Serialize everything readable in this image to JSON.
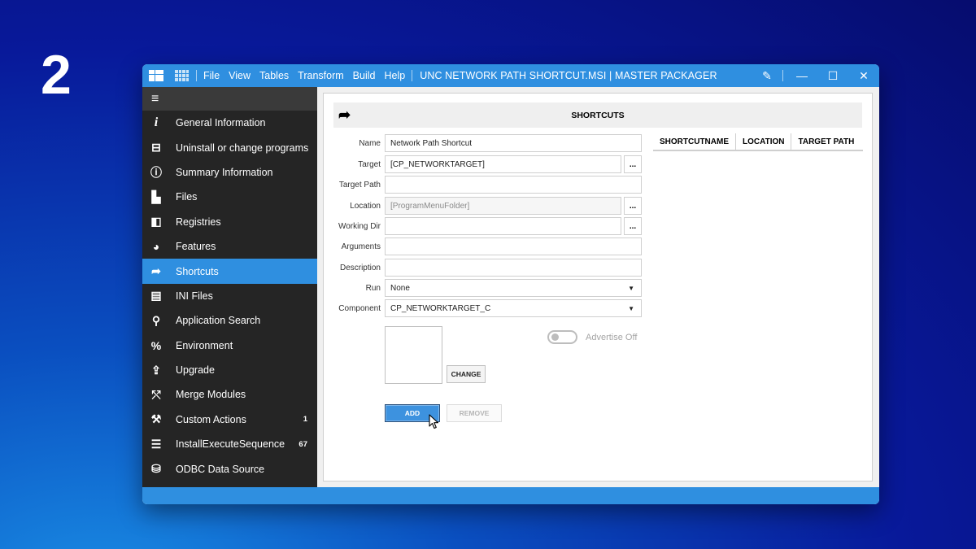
{
  "step": "2",
  "titlebar": {
    "menus": [
      "File",
      "View",
      "Tables",
      "Transform",
      "Build",
      "Help"
    ],
    "title": "UNC NETWORK PATH SHORTCUT.MSI | MASTER PACKAGER",
    "controls": {
      "pen": "✎",
      "minimize": "—",
      "maximize": "☐",
      "close": "✕"
    }
  },
  "sidebar": {
    "menu_icon": "≡",
    "items": [
      {
        "label": "General Information",
        "icon": "info-italic-icon",
        "glyph": "i"
      },
      {
        "label": "Uninstall or change programs",
        "icon": "uninstall-icon",
        "glyph": "⊟"
      },
      {
        "label": "Summary Information",
        "icon": "info-circle-icon",
        "glyph": "ⓘ"
      },
      {
        "label": "Files",
        "icon": "file-icon",
        "glyph": "▙"
      },
      {
        "label": "Registries",
        "icon": "registry-icon",
        "glyph": "◧"
      },
      {
        "label": "Features",
        "icon": "pie-icon",
        "glyph": "◕"
      },
      {
        "label": "Shortcuts",
        "icon": "shortcut-arrow-icon",
        "glyph": "➦"
      },
      {
        "label": "INI Files",
        "icon": "document-icon",
        "glyph": "▤"
      },
      {
        "label": "Application Search",
        "icon": "search-icon",
        "glyph": "⚲"
      },
      {
        "label": "Environment",
        "icon": "percent-icon",
        "glyph": "%"
      },
      {
        "label": "Upgrade",
        "icon": "upload-icon",
        "glyph": "⇪"
      },
      {
        "label": "Merge Modules",
        "icon": "merge-icon",
        "glyph": "⤲"
      },
      {
        "label": "Custom Actions",
        "icon": "tools-icon",
        "glyph": "⚒",
        "badge": "1"
      },
      {
        "label": "InstallExecuteSequence",
        "icon": "list-icon",
        "glyph": "☰",
        "badge": "67"
      },
      {
        "label": "ODBC Data Source",
        "icon": "database-icon",
        "glyph": "⛁"
      }
    ],
    "active_index": 6
  },
  "panel": {
    "title": "SHORTCUTS",
    "header_icon": "➦",
    "fields": {
      "name": {
        "label": "Name",
        "value": "Network Path Shortcut"
      },
      "target": {
        "label": "Target",
        "value": "[CP_NETWORKTARGET]"
      },
      "target_path": {
        "label": "Target Path",
        "value": ""
      },
      "location": {
        "label": "Location",
        "value": "[ProgramMenuFolder]"
      },
      "working_dir": {
        "label": "Working Dir",
        "value": ""
      },
      "arguments": {
        "label": "Arguments",
        "value": ""
      },
      "description": {
        "label": "Description",
        "value": ""
      },
      "run": {
        "label": "Run",
        "value": "None"
      },
      "component": {
        "label": "Component",
        "value": "CP_NETWORKTARGET_C"
      }
    },
    "browse_label": "...",
    "change_label": "CHANGE",
    "advertise_label": "Advertise Off",
    "advertise_on": false,
    "add_label": "ADD",
    "remove_label": "REMOVE",
    "table_columns": [
      "SHORTCUTNAME",
      "LOCATION",
      "TARGET PATH"
    ]
  }
}
